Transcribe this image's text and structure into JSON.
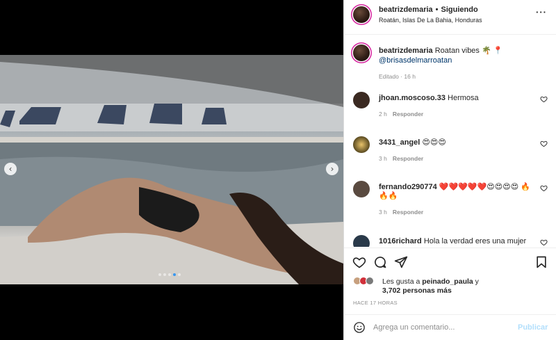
{
  "post": {
    "username": "beatrizdemaria",
    "follow_status": "Siguiendo",
    "location": "Roatán, Islas De La Bahia, Honduras",
    "more_icon": "more-horizontal-icon",
    "caption_user": "beatrizdemaria",
    "caption_text": "Roatan vibes 🌴 📍",
    "caption_mention": "@brisasdelmarroatan",
    "caption_time": "Editado · 16 h"
  },
  "carousel": {
    "slides_total": 5,
    "active_slide": 4
  },
  "comments": [
    {
      "user": "jhoan.moscoso.33",
      "text": "Hermosa",
      "time": "2 h",
      "reply": "Responder",
      "avatar_color": "#3b2a22"
    },
    {
      "user": "3431_angel",
      "text": "😍😍😍",
      "time": "3 h",
      "reply": "Responder",
      "avatar_color": "#7a6a3a"
    },
    {
      "user": "fernando290774",
      "text": "❤️❤️❤️❤️❤️😍😍😍😍 🔥🔥🔥",
      "time": "3 h",
      "reply": "Responder",
      "avatar_color": "#5a4a40"
    },
    {
      "user": "1016richard",
      "text": "Hola la verdad eres una mujer",
      "time": "",
      "reply": "",
      "avatar_color": "#2a3a4a"
    }
  ],
  "likes": {
    "prefix": "Les gusta a",
    "user": "peinado_paula",
    "suffix": "y",
    "count_text": "3,702 personas más"
  },
  "timeago": "HACE 17 HORAS",
  "composer": {
    "placeholder": "Agrega un comentario...",
    "publish_label": "Publicar"
  },
  "colors": {
    "link": "#00376b",
    "muted": "#8e8e8e",
    "accent": "#3897f0",
    "publish_disabled": "#b2dffc"
  }
}
